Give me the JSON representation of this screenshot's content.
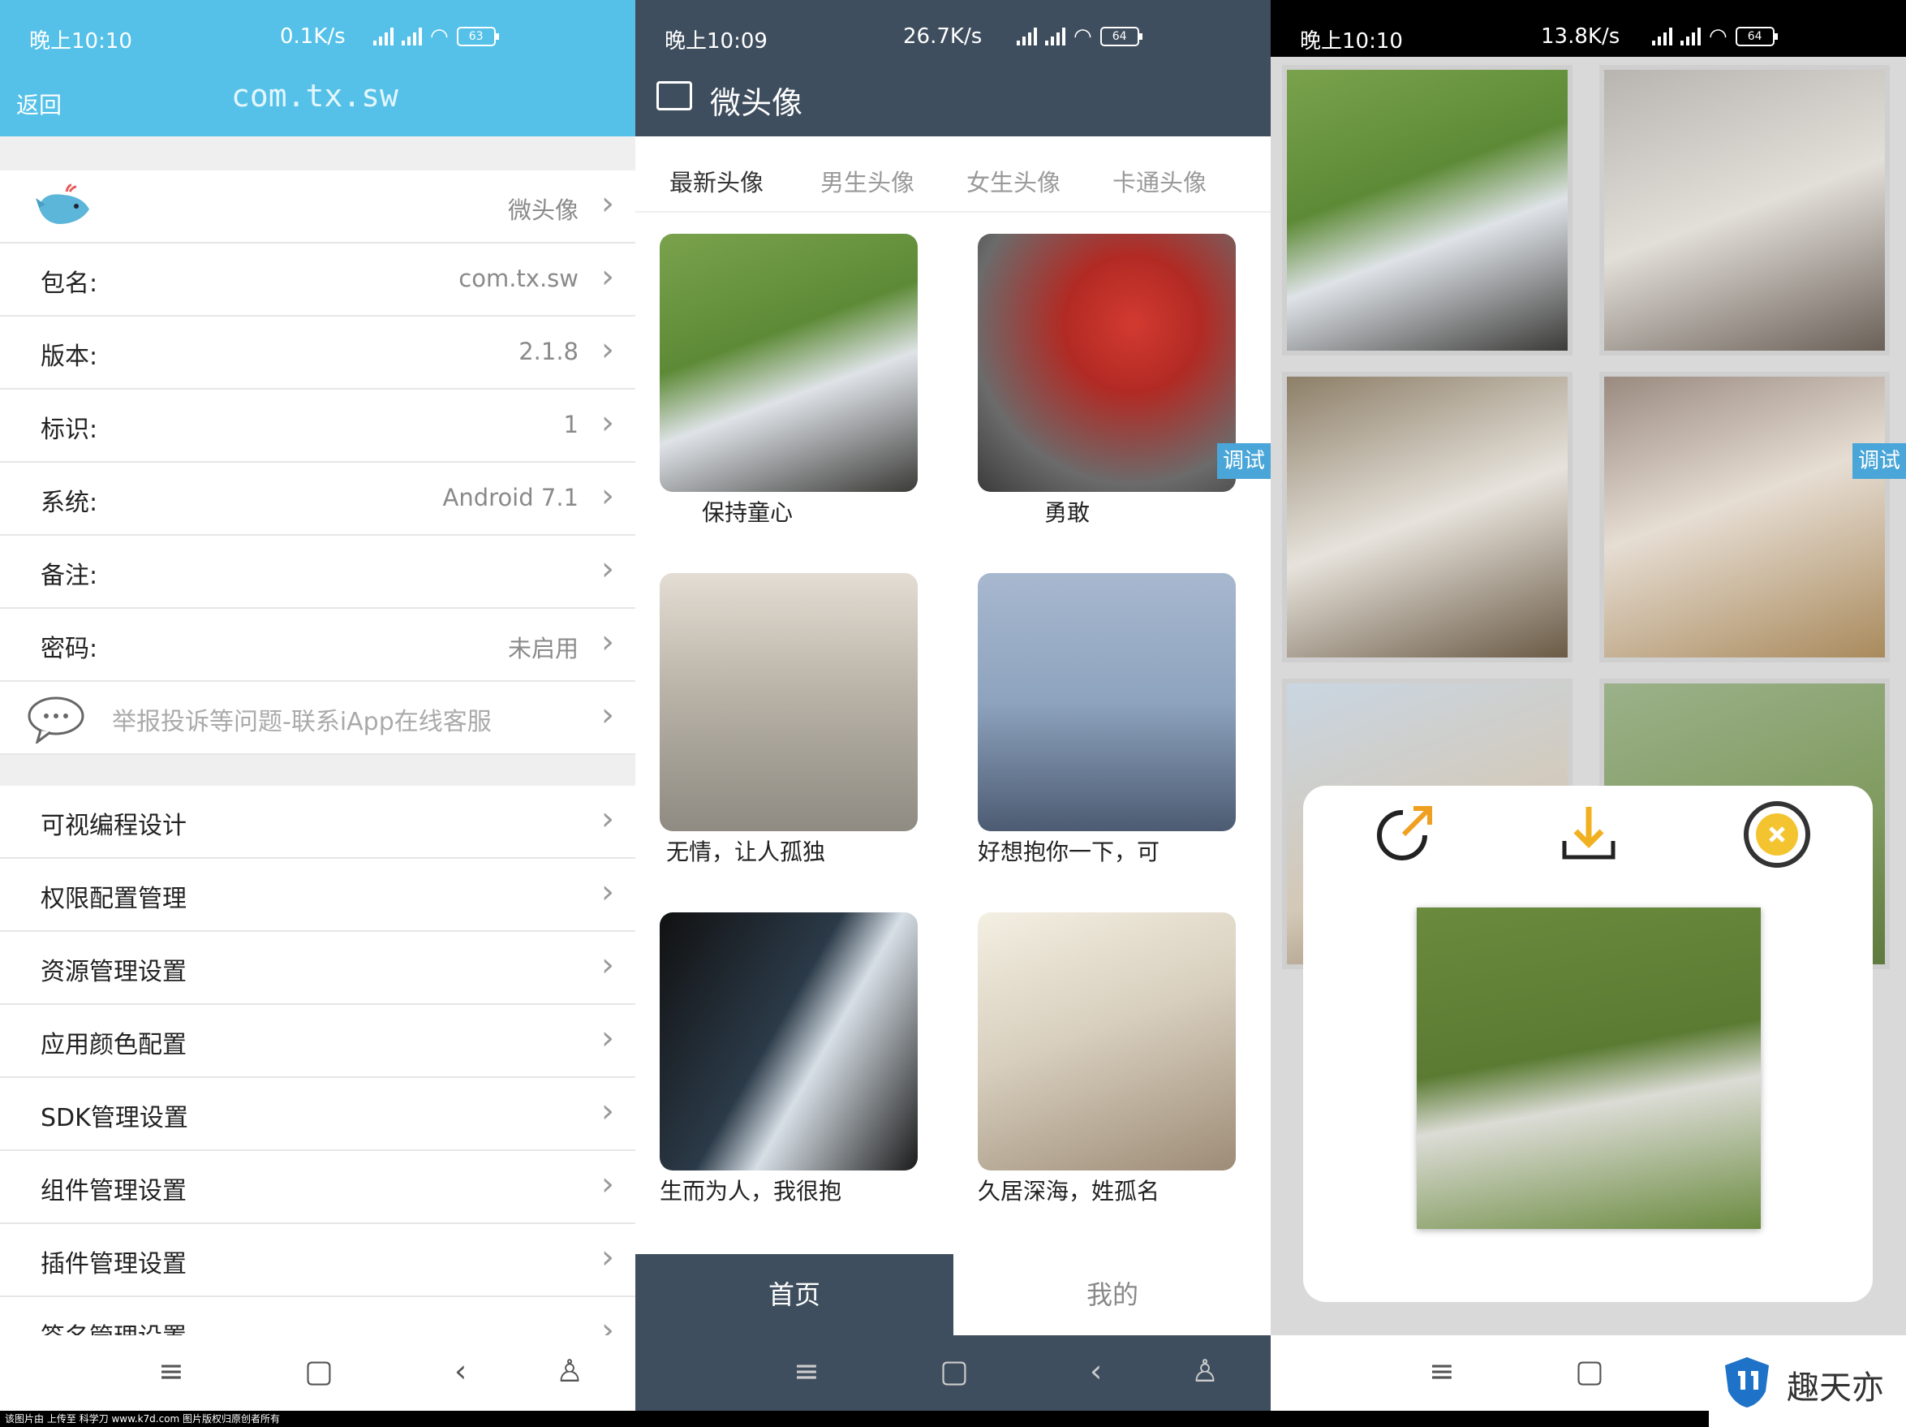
{
  "panels": {
    "settings": {
      "status": {
        "time": "晚上10:10",
        "speed": "0.1K/s",
        "battery": "63"
      },
      "header": {
        "back": "返回",
        "title": "com.tx.sw"
      },
      "rows": [
        {
          "label": "",
          "value": "微头像"
        },
        {
          "label": "包名:",
          "value": "com.tx.sw"
        },
        {
          "label": "版本:",
          "value": "2.1.8"
        },
        {
          "label": "标识:",
          "value": "1"
        },
        {
          "label": "系统:",
          "value": "Android 7.1"
        },
        {
          "label": "备注:",
          "value": ""
        },
        {
          "label": "密码:",
          "value": "未启用"
        },
        {
          "label": "举报投诉等问题-联系iApp在线客服",
          "value": ""
        }
      ],
      "menu": [
        "可视编程设计",
        "权限配置管理",
        "资源管理设置",
        "应用颜色配置",
        "SDK管理设置",
        "组件管理设置",
        "插件管理设置",
        "签名管理设置"
      ]
    },
    "home": {
      "status": {
        "time": "晚上10:09",
        "speed": "26.7K/s",
        "battery": "64"
      },
      "title": "微头像",
      "tabs": [
        "最新头像",
        "男生头像",
        "女生头像",
        "卡通头像"
      ],
      "cards": [
        "保持童心",
        "勇敢",
        "无情，让人孤独",
        "好想抱你一下，可",
        "生而为人，我很抱",
        "久居深海，姓孤名"
      ],
      "debug": "调试",
      "bottom": {
        "home": "首页",
        "mine": "我的"
      }
    },
    "preview": {
      "status": {
        "time": "晚上10:10",
        "speed": "13.8K/s",
        "battery": "64"
      },
      "debug": "调试"
    }
  },
  "watermark": "趣天亦",
  "footer": "该图片由 上传至 科学刀 www.k7d.com 图片版权归原创者所有",
  "colors": {
    "settings_header": "#55c1e8",
    "home_header": "#3f4e5e",
    "debug": "#4aa6d8"
  },
  "icons": [
    "whale-icon",
    "chat-icon",
    "menu-icon",
    "square-icon",
    "back-icon",
    "accessibility-icon",
    "share-icon",
    "download-icon",
    "close-icon",
    "shield-logo-icon"
  ]
}
